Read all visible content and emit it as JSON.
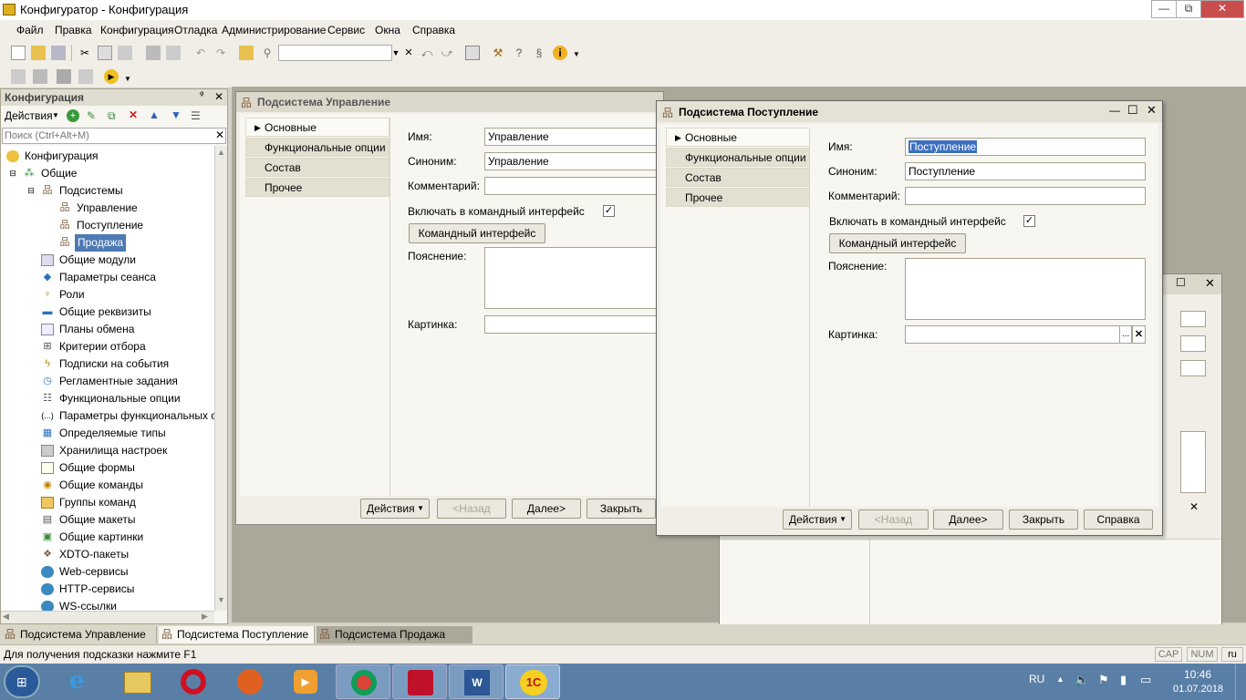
{
  "window": {
    "title": "Конфигуратор - Конфигурация",
    "min": "—",
    "max": "⧉",
    "close": "✕"
  },
  "menu": [
    "Файл",
    "Правка",
    "Конфигурация",
    "Отладка",
    "Администрирование",
    "Сервис",
    "Окна",
    "Справка"
  ],
  "toolbar_search_clear": "✕",
  "left_panel": {
    "title": "Конфигурация",
    "actions_label": "Действия",
    "search_placeholder": "Поиск (Ctrl+Alt+M)",
    "close": "✕",
    "tree": [
      {
        "label": "Конфигурация",
        "icon": "config-icon"
      },
      {
        "label": "Общие",
        "icon": "common-icon"
      },
      {
        "label": "Подсистемы",
        "icon": "subsystems-icon"
      },
      {
        "label": "Управление",
        "icon": "subsystem-icon"
      },
      {
        "label": "Поступление",
        "icon": "subsystem-icon"
      },
      {
        "label": "Продажа",
        "icon": "subsystem-icon"
      },
      {
        "label": "Общие модули",
        "icon": "module-icon"
      },
      {
        "label": "Параметры сеанса",
        "icon": "session-icon"
      },
      {
        "label": "Роли",
        "icon": "role-icon"
      },
      {
        "label": "Общие реквизиты",
        "icon": "attribute-icon"
      },
      {
        "label": "Планы обмена",
        "icon": "exchange-icon"
      },
      {
        "label": "Критерии отбора",
        "icon": "filter-icon"
      },
      {
        "label": "Подписки на события",
        "icon": "event-icon"
      },
      {
        "label": "Регламентные задания",
        "icon": "clock-icon"
      },
      {
        "label": "Функциональные опции",
        "icon": "options-icon"
      },
      {
        "label": "Параметры функциональных опци",
        "icon": "params-icon"
      },
      {
        "label": "Определяемые типы",
        "icon": "types-icon"
      },
      {
        "label": "Хранилища настроек",
        "icon": "storage-icon"
      },
      {
        "label": "Общие формы",
        "icon": "form-icon"
      },
      {
        "label": "Общие команды",
        "icon": "command-icon"
      },
      {
        "label": "Группы команд",
        "icon": "folder-icon"
      },
      {
        "label": "Общие макеты",
        "icon": "template-icon"
      },
      {
        "label": "Общие картинки",
        "icon": "picture-icon"
      },
      {
        "label": "XDTO-пакеты",
        "icon": "xdto-icon"
      },
      {
        "label": "Web-сервисы",
        "icon": "web-icon"
      },
      {
        "label": "HTTP-сервисы",
        "icon": "http-icon"
      },
      {
        "label": "WS-ссылки",
        "icon": "ws-icon"
      }
    ]
  },
  "win1": {
    "title": "Подсистема Управление",
    "tabs": [
      "Основные",
      "Функциональные опции",
      "Состав",
      "Прочее"
    ],
    "name_label": "Имя:",
    "name_value": "Управление",
    "synonym_label": "Синоним:",
    "synonym_value": "Управление",
    "comment_label": "Комментарий:",
    "include_label": "Включать в командный интерфейс",
    "cmd_button": "Командный интерфейс",
    "explanation_label": "Пояснение:",
    "picture_label": "Картинка:",
    "btn_actions": "Действия",
    "btn_back": "<Назад",
    "btn_next": "Далее>",
    "btn_close": "Закрыть"
  },
  "win2": {
    "title": "Подсистема Поступление",
    "tabs": [
      "Основные",
      "Функциональные опции",
      "Состав",
      "Прочее"
    ],
    "name_label": "Имя:",
    "name_value": "Поступление",
    "synonym_label": "Синоним:",
    "synonym_value": "Поступление",
    "comment_label": "Комментарий:",
    "include_label": "Включать в командный интерфейс",
    "cmd_button": "Командный интерфейс",
    "explanation_label": "Пояснение:",
    "picture_label": "Картинка:",
    "pic_browse": "...",
    "pic_clear": "✕",
    "btn_actions": "Действия",
    "btn_back": "<Назад",
    "btn_next": "Далее>",
    "btn_close": "Закрыть",
    "btn_help": "Справка"
  },
  "doc_tabs": [
    "Подсистема Управление",
    "Подсистема Поступление",
    "Подсистема Продажа"
  ],
  "status": {
    "hint": "Для получения подсказки нажмите F1",
    "cap": "CAP",
    "num": "NUM",
    "lang": "ru"
  },
  "taskbar": {
    "lang": "RU",
    "time": "10:46",
    "date": "01.07.2018"
  }
}
